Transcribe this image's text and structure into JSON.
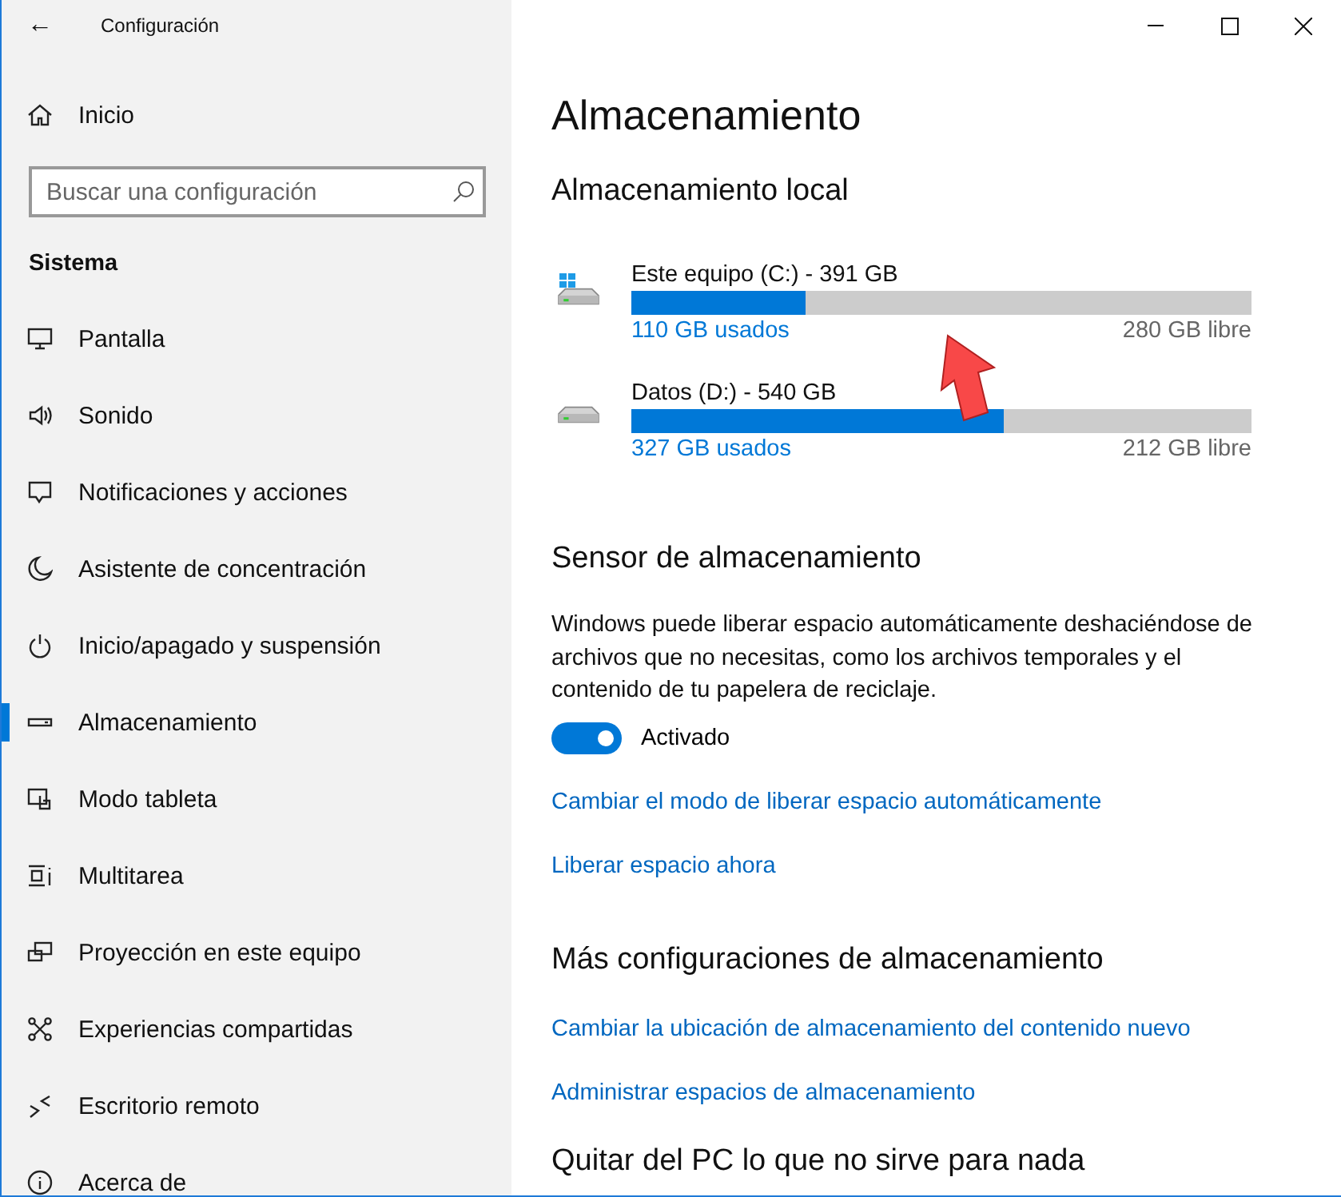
{
  "window": {
    "title": "Configuración",
    "back": "←"
  },
  "sidebar": {
    "home": "Inicio",
    "search": {
      "placeholder": "Buscar una configuración"
    },
    "section": "Sistema",
    "items": [
      {
        "label": "Pantalla",
        "selected": false
      },
      {
        "label": "Sonido",
        "selected": false
      },
      {
        "label": "Notificaciones y acciones",
        "selected": false
      },
      {
        "label": "Asistente de concentración",
        "selected": false
      },
      {
        "label": "Inicio/apagado y suspensión",
        "selected": false
      },
      {
        "label": "Almacenamiento",
        "selected": true
      },
      {
        "label": "Modo tableta",
        "selected": false
      },
      {
        "label": "Multitarea",
        "selected": false
      },
      {
        "label": "Proyección en este equipo",
        "selected": false
      },
      {
        "label": "Experiencias compartidas",
        "selected": false
      },
      {
        "label": "Escritorio remoto",
        "selected": false
      },
      {
        "label": "Acerca de",
        "selected": false
      }
    ]
  },
  "main": {
    "title": "Almacenamiento",
    "local_heading": "Almacenamiento local",
    "drives": [
      {
        "kind": "system",
        "name": "Este equipo (C:) - 391 GB",
        "level": 0.28,
        "used": "110 GB usados",
        "free": "280 GB libre"
      },
      {
        "kind": "data",
        "name": "Datos (D:) - 540 GB",
        "level": 0.6,
        "used": "327 GB usados",
        "free": "212 GB libre"
      }
    ],
    "sensor": {
      "heading": "Sensor de almacenamiento",
      "description": "Windows puede liberar espacio automáticamente deshaciéndose de archivos que no necesitas, como los archivos temporales y el contenido de tu papelera de reciclaje.",
      "toggle": {
        "on": true,
        "label": "Activado"
      },
      "links": [
        "Cambiar el modo de liberar espacio automáticamente",
        "Liberar espacio ahora"
      ]
    },
    "more": {
      "heading": "Más configuraciones de almacenamiento",
      "links": [
        "Cambiar la ubicación de almacenamiento del contenido nuevo",
        "Administrar espacios de almacenamiento"
      ]
    },
    "next_heading": "Quitar del PC lo que no sirve para nada"
  },
  "annotation": {
    "kind": "arrow"
  }
}
